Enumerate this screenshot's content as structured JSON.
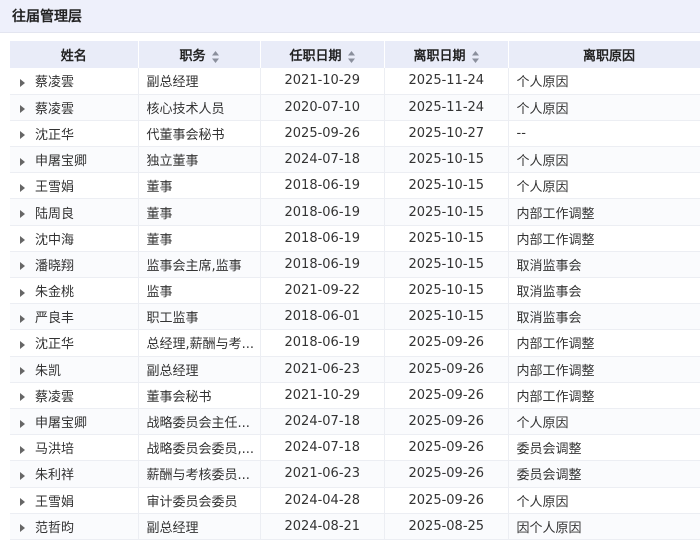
{
  "title": "往届管理层",
  "columns": [
    "姓名",
    "职务",
    "任职日期",
    "离职日期",
    "离职原因"
  ],
  "rows": [
    [
      "蔡凌雲",
      "副总经理",
      "2021-10-29",
      "2025-11-24",
      "个人原因"
    ],
    [
      "蔡凌雲",
      "核心技术人员",
      "2020-07-10",
      "2025-11-24",
      "个人原因"
    ],
    [
      "沈正华",
      "代董事会秘书",
      "2025-09-26",
      "2025-10-27",
      "--"
    ],
    [
      "申屠宝卿",
      "独立董事",
      "2024-07-18",
      "2025-10-15",
      "个人原因"
    ],
    [
      "王雪娟",
      "董事",
      "2018-06-19",
      "2025-10-15",
      "个人原因"
    ],
    [
      "陆周良",
      "董事",
      "2018-06-19",
      "2025-10-15",
      "内部工作调整"
    ],
    [
      "沈中海",
      "董事",
      "2018-06-19",
      "2025-10-15",
      "内部工作调整"
    ],
    [
      "潘晓翔",
      "监事会主席,监事",
      "2018-06-19",
      "2025-10-15",
      "取消监事会"
    ],
    [
      "朱金桃",
      "监事",
      "2021-09-22",
      "2025-10-15",
      "取消监事会"
    ],
    [
      "严良丰",
      "职工监事",
      "2018-06-01",
      "2025-10-15",
      "取消监事会"
    ],
    [
      "沈正华",
      "总经理,薪酬与考...",
      "2018-06-19",
      "2025-09-26",
      "内部工作调整"
    ],
    [
      "朱凯",
      "副总经理",
      "2021-06-23",
      "2025-09-26",
      "内部工作调整"
    ],
    [
      "蔡凌雲",
      "董事会秘书",
      "2021-10-29",
      "2025-09-26",
      "内部工作调整"
    ],
    [
      "申屠宝卿",
      "战略委员会主任...",
      "2024-07-18",
      "2025-09-26",
      "个人原因"
    ],
    [
      "马洪培",
      "战略委员会委员,...",
      "2024-07-18",
      "2025-09-26",
      "委员会调整"
    ],
    [
      "朱利祥",
      "薪酬与考核委员...",
      "2021-06-23",
      "2025-09-26",
      "委员会调整"
    ],
    [
      "王雪娟",
      "审计委员会委员",
      "2024-04-28",
      "2025-09-26",
      "个人原因"
    ],
    [
      "范哲昀",
      "副总经理",
      "2024-08-21",
      "2025-08-25",
      "因个人原因"
    ]
  ]
}
